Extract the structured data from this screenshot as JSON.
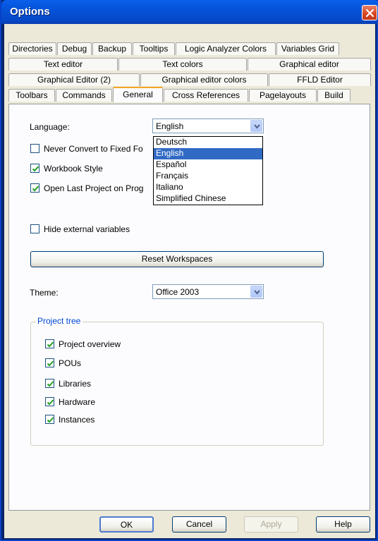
{
  "window": {
    "title": "Options"
  },
  "tabs": {
    "row1": [
      "Directories",
      "Debug",
      "Backup",
      "Tooltips",
      "Logic Analyzer Colors",
      "Variables Grid"
    ],
    "row2": [
      "Text editor",
      "Text colors",
      "Graphical editor"
    ],
    "row3": [
      "Graphical Editor (2)",
      "Graphical editor colors",
      "FFLD Editor"
    ],
    "row4": [
      "Toolbars",
      "Commands",
      "General",
      "Cross References",
      "Pagelayouts",
      "Build"
    ],
    "active": "General"
  },
  "general": {
    "language_label": "Language:",
    "language_value": "English",
    "language_options": [
      "Deutsch",
      "English",
      "Español",
      "Français",
      "Italiano",
      "Simplified Chinese"
    ],
    "language_selected": "English",
    "never_convert_label": "Never Convert to Fixed Fo",
    "workbook_style_label": "Workbook Style",
    "open_last_label": "Open Last Project on Prog",
    "hide_external_label": "Hide external variables",
    "reset_workspaces_label": "Reset Workspaces",
    "theme_label": "Theme:",
    "theme_value": "Office 2003",
    "project_tree_title": "Project tree",
    "project_tree_items": [
      {
        "label": "Project overview",
        "checked": true
      },
      {
        "label": "POUs",
        "checked": true
      },
      {
        "label": "Libraries",
        "checked": true
      },
      {
        "label": "Hardware",
        "checked": true
      },
      {
        "label": "Instances",
        "checked": true
      }
    ]
  },
  "buttons": {
    "ok": "OK",
    "cancel": "Cancel",
    "apply": "Apply",
    "help": "Help"
  }
}
